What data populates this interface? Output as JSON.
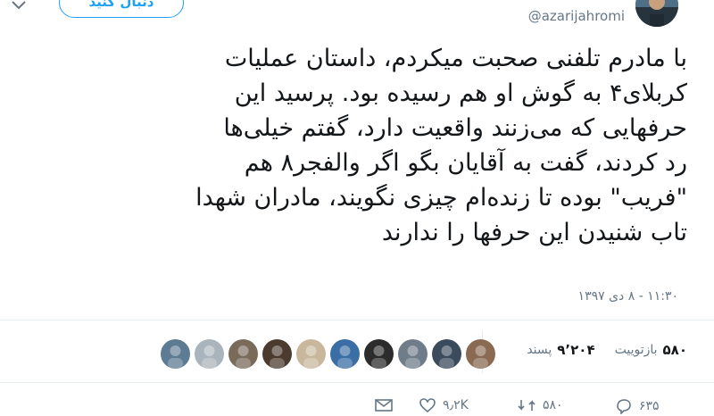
{
  "header": {
    "follow_label": "دنبال کنید",
    "handle": "@azarijahromi"
  },
  "tweet": {
    "text": "با مادرم تلفنی صحبت میکردم، داستان عملیات\nکربلای۴ به گوش او هم رسیده بود. پرسید این\nحرفهایی که می‌زنند واقعیت دارد، گفتم خیلی‌ها\nرد کردند، گفت به آقایان بگو اگر والفجر۸ هم\n\"فریب\" بوده تا زنده‌ام چیزی نگویند، مادران شهدا\nتاب شنیدن این حرفها را ندارند",
    "timestamp": "۱۱:۳۰ - ۸ دی ۱۳۹۷"
  },
  "stats": {
    "retweets_count": "۵۸۰",
    "retweets_label": "بازتوییت",
    "likes_count": "۹٬۲۰۴",
    "likes_label": "پسند"
  },
  "actions": {
    "reply_count": "۶۳۵",
    "retweet_count": "۵۸۰",
    "like_count": "۹٫۲K"
  },
  "colors": {
    "accent": "#1da1f2",
    "text": "#14171a",
    "secondary": "#657786",
    "divider": "#e6ecf0"
  },
  "likers": [
    {
      "name": "liker-avatar",
      "color": "#8a6a52"
    },
    {
      "name": "liker-avatar",
      "color": "#3b4a5c"
    },
    {
      "name": "liker-avatar",
      "color": "#6f7d8a"
    },
    {
      "name": "liker-avatar",
      "color": "#2c2c2c"
    },
    {
      "name": "liker-avatar",
      "color": "#3a6ea5"
    },
    {
      "name": "liker-avatar",
      "color": "#c9b79c"
    },
    {
      "name": "liker-avatar",
      "color": "#4b3b2f"
    },
    {
      "name": "liker-avatar",
      "color": "#7a6a5a"
    },
    {
      "name": "liker-avatar",
      "color": "#aab4bd"
    },
    {
      "name": "liker-avatar",
      "color": "#5d7b93"
    }
  ]
}
